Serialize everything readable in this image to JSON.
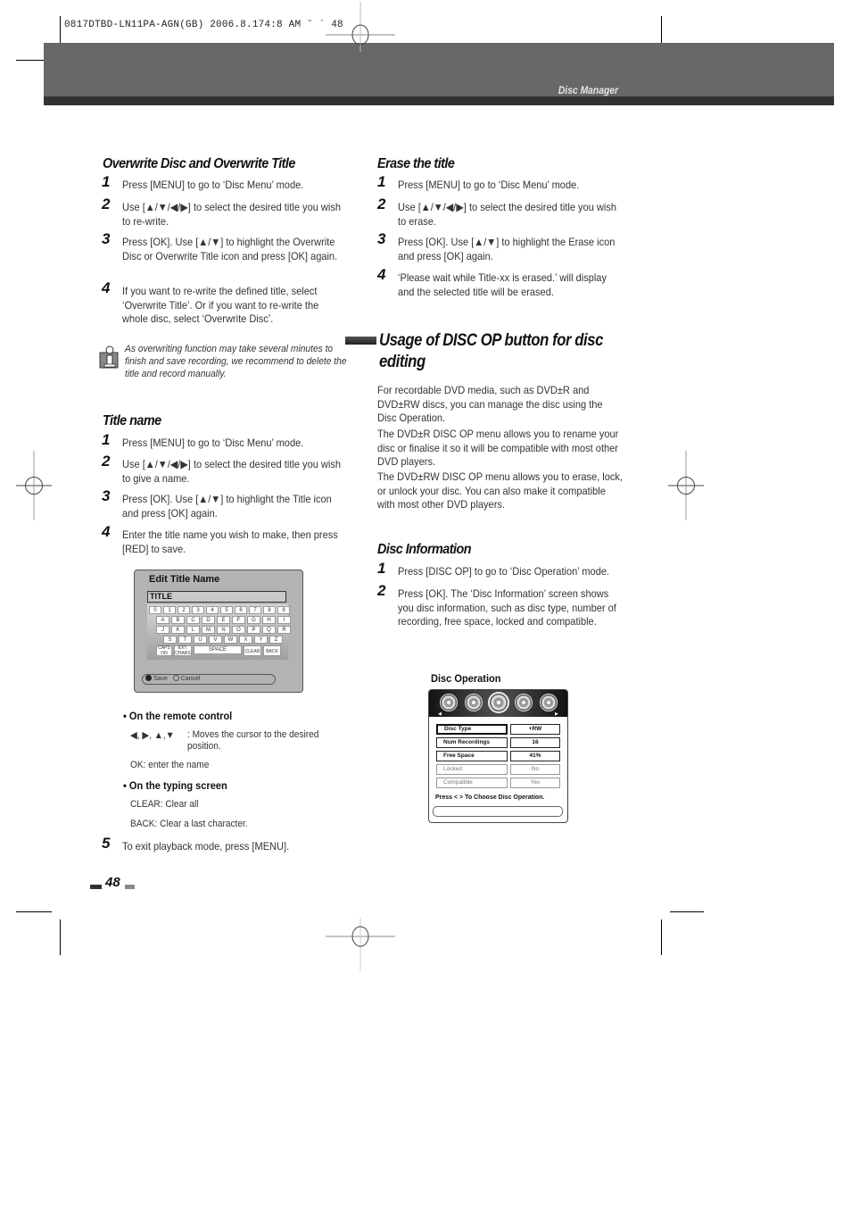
{
  "print_slug": "0817DTBD-LN11PA-AGN(GB) 2006.8.174:8 AM ˘ ` 48",
  "header": {
    "section_title": "Disc Manager"
  },
  "overwrite": {
    "title": "Overwrite Disc and Overwrite Title",
    "steps": [
      {
        "n": "1",
        "text": "Press [MENU] to go to  ‘Disc Menu’ mode."
      },
      {
        "n": "2",
        "text": "Use [▲/▼/◀/▶] to select the desired title you wish to re-write."
      },
      {
        "n": "3",
        "text": "Press [OK].  Use [▲/▼] to highlight the Overwrite Disc or Overwrite Title icon and press [OK] again."
      },
      {
        "n": "4",
        "text": "If you want to re-write the defined title, select ‘Overwrite Title’. Or if you want to re-write the whole disc, select ‘Overwrite Disc’."
      }
    ],
    "note": "As overwriting function may take several minutes to finish and save recording, we recommend to delete the title and record manually."
  },
  "title_name": {
    "title": "Title name",
    "steps": [
      {
        "n": "1",
        "text": "Press [MENU] to go to  ‘Disc Menu’ mode."
      },
      {
        "n": "2",
        "text": "Use [▲/▼/◀/▶] to select the desired title you wish to give a name."
      },
      {
        "n": "3",
        "text": "Press [OK].  Use [▲/▼] to highlight the Title icon and press [OK] again."
      },
      {
        "n": "4",
        "text": "Enter the title name you wish to make, then press [RED] to save."
      },
      {
        "n": "5",
        "text": "To exit playback mode, press [MENU]."
      }
    ],
    "screen": {
      "heading": "Edit Title Name",
      "field_value": "TITLE",
      "keys_row1": [
        "0",
        "1",
        "2",
        "3",
        "4",
        "5",
        "6",
        "7",
        "8",
        "9"
      ],
      "keys_row2": [
        "A",
        "B",
        "C",
        "D",
        "E",
        "F",
        "G",
        "H",
        "I"
      ],
      "keys_row3": [
        "J",
        "K",
        "L",
        "M",
        "N",
        "O",
        "P",
        "Q",
        "R"
      ],
      "keys_row4": [
        "S",
        "T",
        "U",
        "V",
        "W",
        "X",
        "Y",
        "Z"
      ],
      "caps": "CAPS ON",
      "ext": "EXT. CHARS",
      "space": "SPACE",
      "clear": "CLEAR",
      "back": "BACK",
      "save": "Save",
      "cancel": "Cancel"
    },
    "remote_heading": "• On the remote control",
    "remote_arrows": "◀, ▶, ▲,▼",
    "remote_desc": ": Moves the cursor to the desired position.",
    "remote_ok": "OK: enter the name",
    "typing_heading": "• On the typing screen",
    "typing_clear": "CLEAR: Clear all",
    "typing_back": "BACK: Clear a last character."
  },
  "erase": {
    "title": "Erase the title",
    "steps": [
      {
        "n": "1",
        "text": "Press [MENU] to go to  ‘Disc Menu’ mode."
      },
      {
        "n": "2",
        "text": "Use [▲/▼/◀/▶] to select the desired title you wish to erase."
      },
      {
        "n": "3",
        "text": "Press [OK].  Use [▲/▼] to highlight the Erase icon and press [OK] again."
      },
      {
        "n": "4",
        "text": "‘Please wait while Title-xx is erased.’ will display and the selected title will be erased."
      }
    ]
  },
  "disc_op": {
    "title": "Usage of DISC OP button for disc editing",
    "paras": [
      "For recordable DVD media, such as DVD±R and DVD±RW discs, you can manage the disc using the Disc Operation.",
      "The DVD±R DISC OP menu allows you to rename your disc or finalise it so it will be compatible with most other DVD players.",
      "The DVD±RW DISC OP menu allows you to erase, lock, or unlock your disc. You can also make it compatible with most other DVD players."
    ]
  },
  "disc_info": {
    "title": "Disc Information",
    "steps": [
      {
        "n": "1",
        "text": "Press [DISC OP] to go to ‘Disc Operation’ mode."
      },
      {
        "n": "2",
        "text": "Press [OK].  The ‘Disc Information’ screen shows you disc information, such as disc type, number of recording, free space, locked and compatible."
      }
    ],
    "screen": {
      "heading": "Disc Operation",
      "rows": [
        {
          "key": "Disc Type",
          "value": "+RW"
        },
        {
          "key": "Num Recordings",
          "value": "16"
        },
        {
          "key": "Free Space",
          "value": "41%"
        },
        {
          "key": "Locked",
          "value": "No"
        },
        {
          "key": "Compatible",
          "value": "Yes"
        }
      ],
      "hint": "Press < >  To Choose Disc Operation."
    }
  },
  "page_number": "48"
}
